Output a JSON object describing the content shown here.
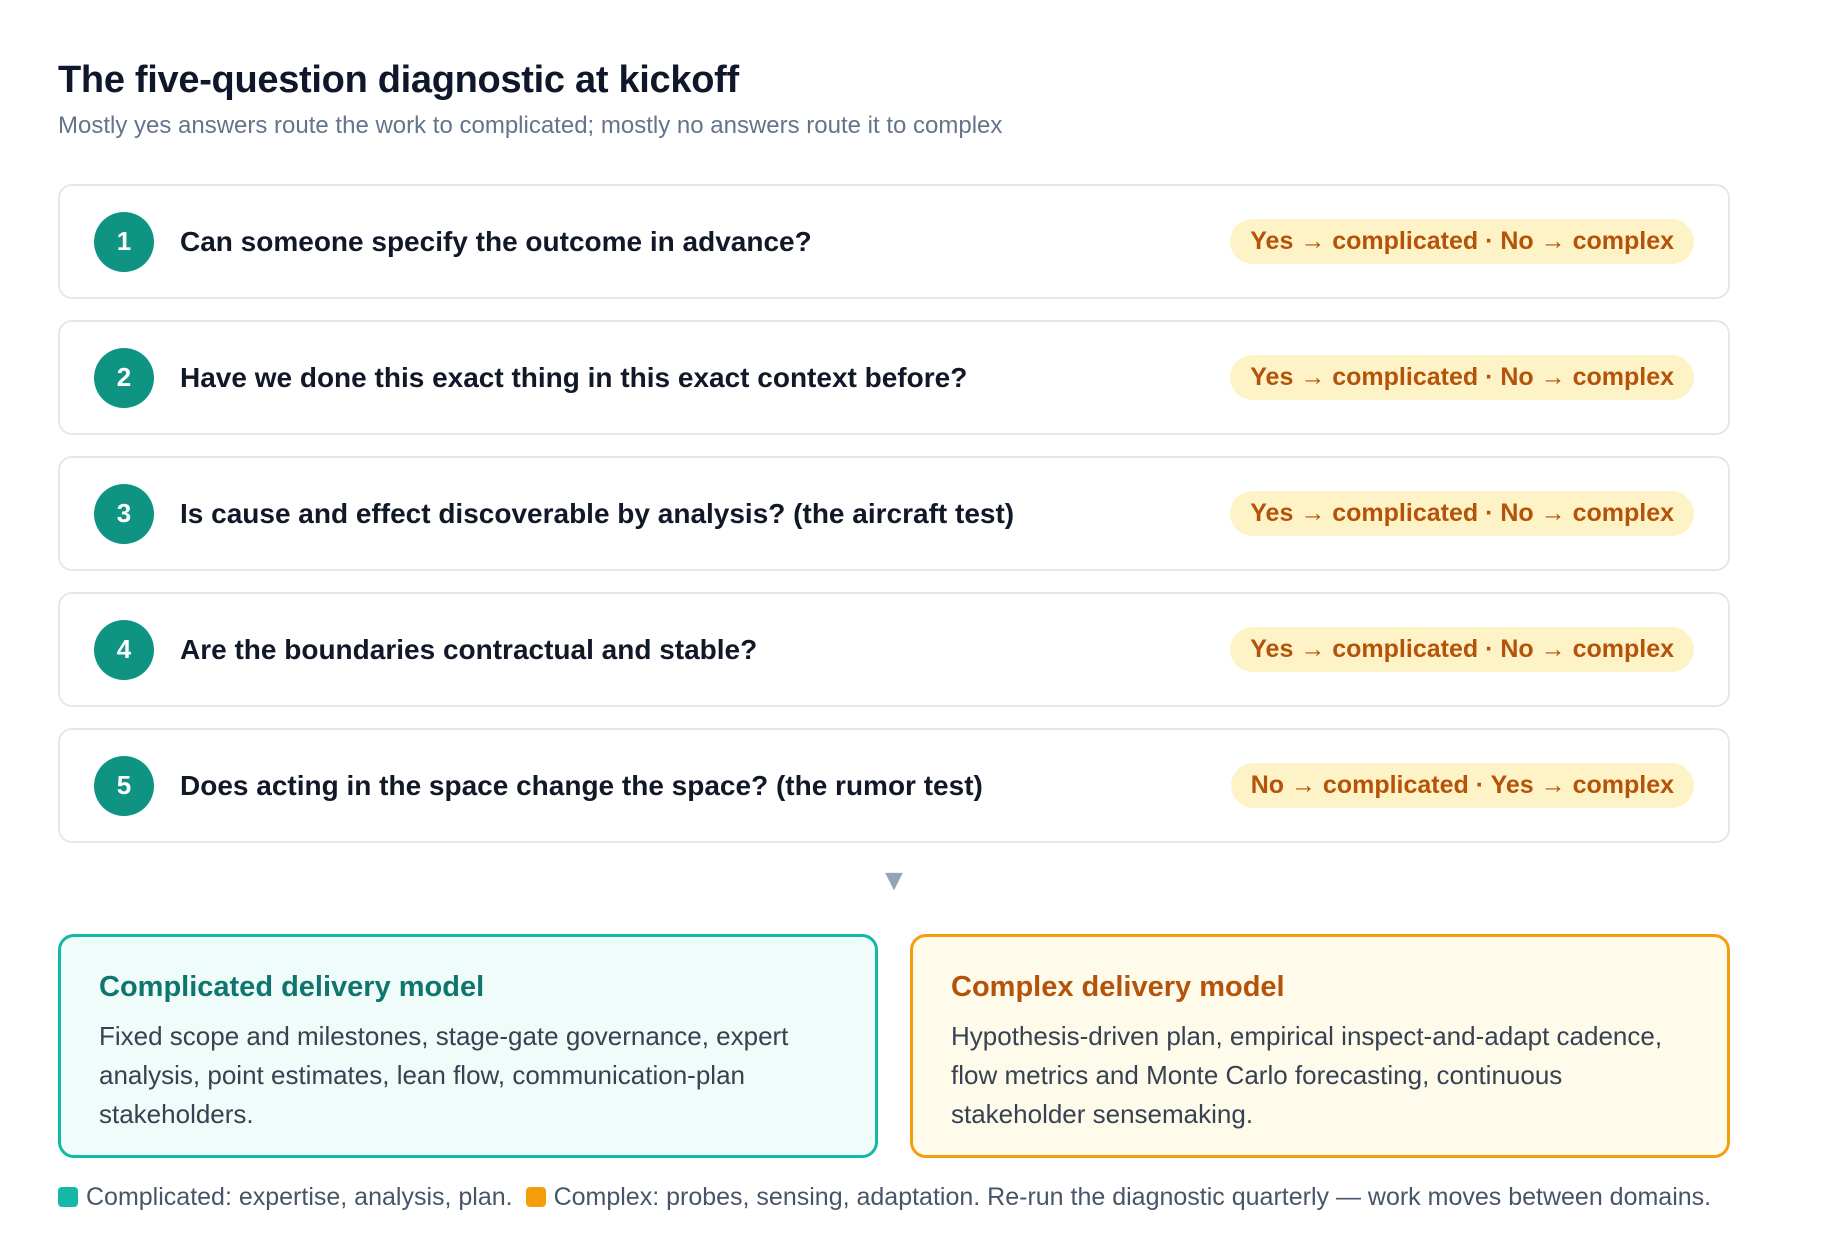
{
  "title": "The five-question diagnostic at kickoff",
  "subtitle": "Mostly yes answers route the work to complicated; mostly no answers route it to complex",
  "questions": [
    {
      "number": "1",
      "text": "Can someone specify the outcome in advance?",
      "routing": "Yes → complicated · No → complex"
    },
    {
      "number": "2",
      "text": "Have we done this exact thing in this exact context before?",
      "routing": "Yes → complicated · No → complex"
    },
    {
      "number": "3",
      "text": "Is cause and effect discoverable by analysis? (the aircraft test)",
      "routing": "Yes → complicated · No → complex"
    },
    {
      "number": "4",
      "text": "Are the boundaries contractual and stable?",
      "routing": "Yes → complicated · No → complex"
    },
    {
      "number": "5",
      "text": "Does acting in the space change the space? (the rumor test)",
      "routing": "No → complicated · Yes → complex"
    }
  ],
  "arrow_glyph": "▼",
  "models": {
    "complicated": {
      "title": "Complicated delivery model",
      "body": "Fixed scope and milestones, stage-gate governance, expert analysis, point estimates, lean flow, communication-plan stakeholders."
    },
    "complex": {
      "title": "Complex delivery model",
      "body": "Hypothesis-driven plan, empirical inspect-and-adapt cadence, flow metrics and Monte Carlo forecasting, continuous stakeholder sensemaking."
    }
  },
  "legend": {
    "complicated_text": "Complicated: expertise, analysis, plan.",
    "complex_text": "Complex: probes, sensing, adaptation. Re-run the diagnostic quarterly — work moves between domains."
  },
  "colors": {
    "teal": "#0f9484",
    "amber": "#f59e0b",
    "pill_bg": "#fef3c7",
    "pill_text": "#b45309"
  }
}
